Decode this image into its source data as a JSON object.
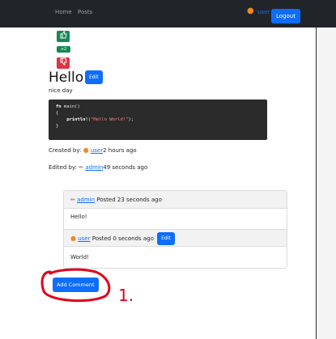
{
  "nav": {
    "links": [
      "Home",
      "Posts"
    ],
    "user": "user",
    "logout": "Logout"
  },
  "votes": {
    "up_icon": "thumbs-up-icon",
    "count": "+2",
    "down_icon": "thumbs-down-icon"
  },
  "post": {
    "title": "Hello",
    "edit_label": "Edit",
    "body": "nice day",
    "code": {
      "line1_kw": "fn",
      "line1_rest": " main()",
      "line2": "{",
      "line3_fn": "    println!",
      "line3_open": "(",
      "line3_str": "\"Hello World!\"",
      "line3_close": ");",
      "line4": "}"
    },
    "created_prefix": "Created by: ",
    "created_user": "user",
    "created_time": "2 hours ago",
    "edited_prefix": "Edited by: ",
    "edited_user": "admin",
    "edited_time": "49 seconds ago"
  },
  "comments": [
    {
      "user": "admin",
      "meta": " Posted 23 seconds ago",
      "body": "Hello!"
    },
    {
      "user": "user",
      "meta": " Posted 0 seconds ago",
      "edit_label": "Edit",
      "body": "World!"
    }
  ],
  "add_comment_label": "Add Comment",
  "annotation": {
    "label": "1.",
    "color": "#e0001b"
  },
  "colors": {
    "navbar": "#212529",
    "primary": "#0d6efd",
    "success": "#198754",
    "danger": "#dc3545"
  }
}
